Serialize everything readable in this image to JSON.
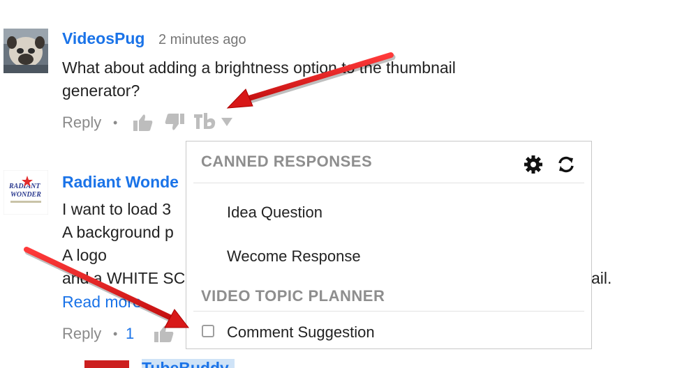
{
  "comments": [
    {
      "author": "VideosPug",
      "time": "2 minutes ago",
      "text_lines": [
        "What about adding a brightness option to the thumbnail",
        "generator?"
      ],
      "reply_label": "Reply"
    },
    {
      "author": "Radiant Wonde",
      "text_lines": [
        "I want to load 3",
        "A background p",
        "A logo",
        "and a WHITE SC",
        "ail."
      ],
      "read_more_label": "Read more",
      "reply_label": "Reply",
      "reply_count": "1"
    }
  ],
  "third_comment_author": "TubeBuddy",
  "popup": {
    "canned_title": "CANNED RESPONSES",
    "canned_items": [
      "Idea Question",
      "Wecome Response"
    ],
    "planner_title": "VIDEO TOPIC PLANNER",
    "planner_items": [
      "Comment Suggestion"
    ]
  },
  "colors": {
    "link": "#1a73e8",
    "arrow": "#e02020",
    "muted": "#8a8a8a",
    "section_title": "#8e8e8e"
  },
  "icons": [
    "thumbs-up-icon",
    "thumbs-down-icon",
    "tubebuddy-icon",
    "dropdown-arrow-icon",
    "gear-icon",
    "refresh-icon",
    "checkbox-icon"
  ]
}
